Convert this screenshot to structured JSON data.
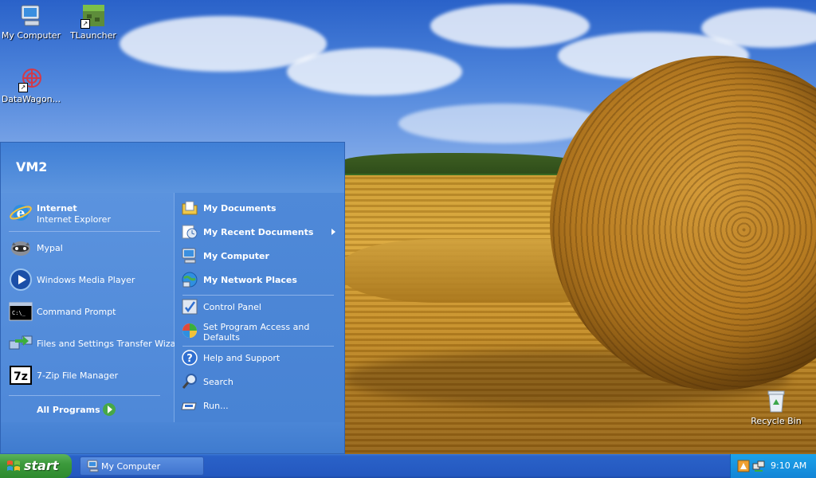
{
  "desktop": {
    "icons": [
      {
        "label": "My Computer",
        "icon": "my-computer-icon"
      },
      {
        "label": "TLauncher",
        "icon": "tlauncher-icon"
      },
      {
        "label": "DataWagon...",
        "icon": "datawagon-icon"
      },
      {
        "label": "Recycle Bin",
        "icon": "recycle-bin-icon"
      }
    ]
  },
  "start_menu": {
    "user_name": "VM2",
    "pinned": [
      {
        "title": "Internet",
        "subtitle": "Internet Explorer",
        "icon": "internet-explorer-icon"
      }
    ],
    "recent_programs": [
      {
        "label": "Mypal",
        "icon": "mypal-icon"
      },
      {
        "label": "Windows Media Player",
        "icon": "media-player-icon"
      },
      {
        "label": "Command Prompt",
        "icon": "command-prompt-icon"
      },
      {
        "label": "Files and Settings Transfer Wizard",
        "icon": "transfer-wizard-icon"
      },
      {
        "label": "7-Zip File Manager",
        "icon": "7zip-icon"
      }
    ],
    "all_programs_label": "All Programs",
    "places": [
      {
        "label": "My Documents",
        "icon": "my-documents-icon"
      },
      {
        "label": "My Recent Documents",
        "icon": "recent-documents-icon"
      },
      {
        "label": "My Computer",
        "icon": "my-computer-icon"
      },
      {
        "label": "My Network Places",
        "icon": "network-places-icon"
      }
    ],
    "settings": [
      {
        "label": "Control Panel",
        "icon": "control-panel-icon"
      },
      {
        "label": "Set Program Access and",
        "label2": "Defaults",
        "icon": "program-access-icon"
      }
    ],
    "tools": [
      {
        "label": "Help and Support",
        "icon": "help-icon"
      },
      {
        "label": "Search",
        "icon": "search-icon"
      },
      {
        "label": "Run...",
        "icon": "run-icon"
      }
    ]
  },
  "taskbar": {
    "start_label": "start",
    "tasks": [
      {
        "label": "My Computer",
        "icon": "my-computer-icon"
      }
    ],
    "clock": "9:10 AM"
  },
  "colors": {
    "start_menu_blue": "#4a84d4",
    "taskbar_blue": "#2458c0",
    "start_green": "#3c9a3c",
    "tray_blue": "#1385d6"
  }
}
